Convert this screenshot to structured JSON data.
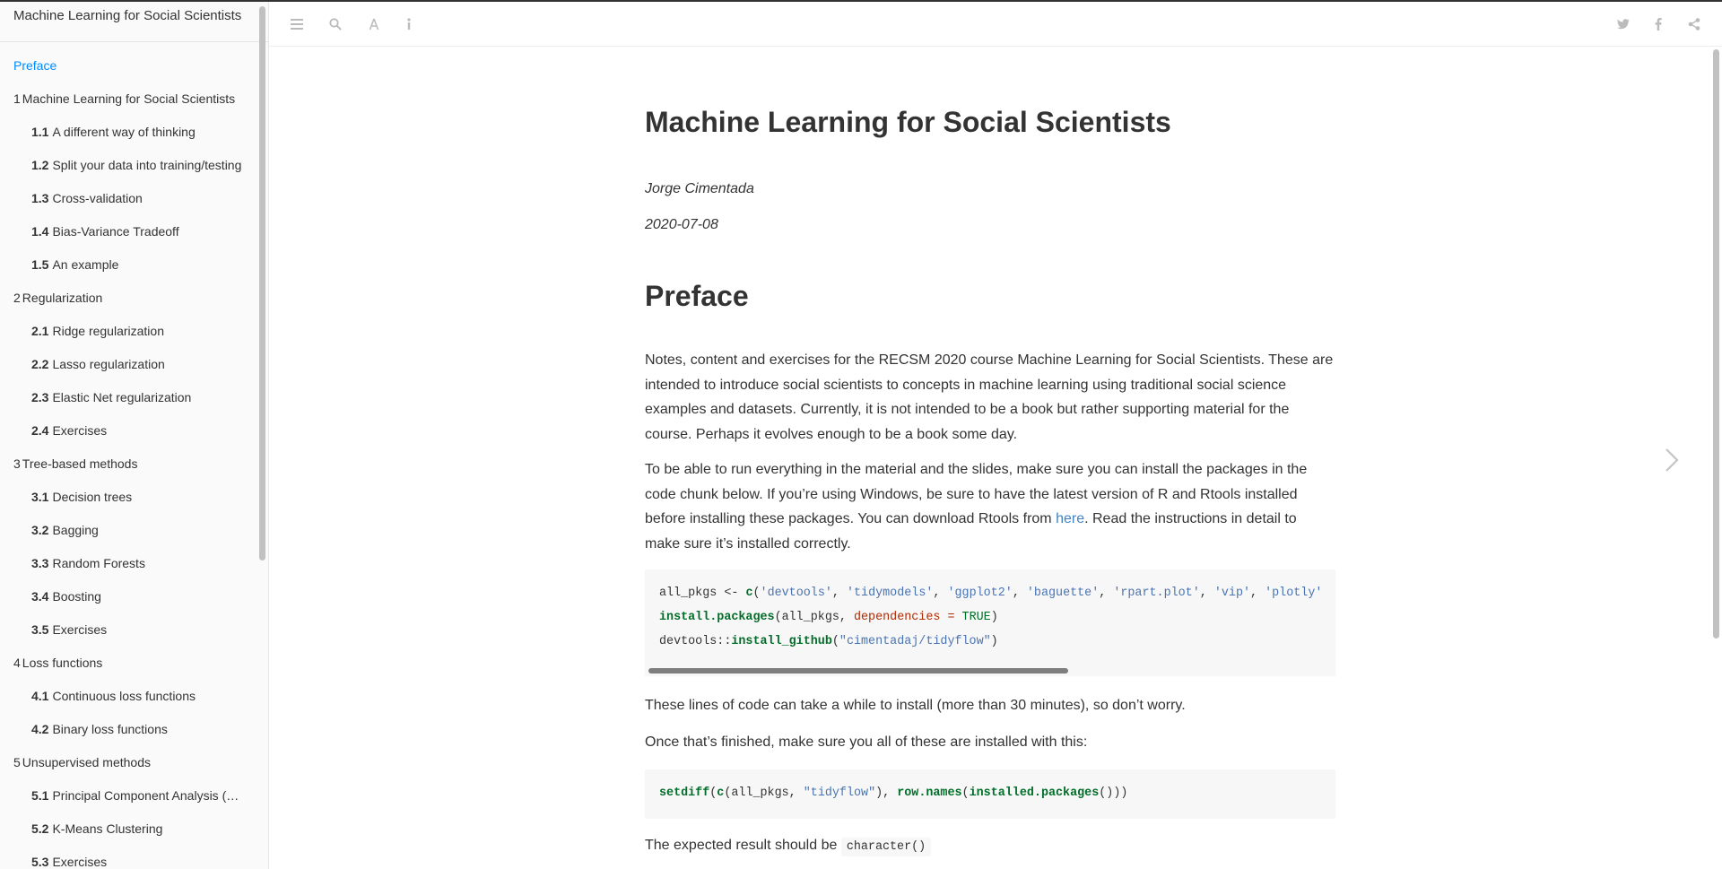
{
  "sidebar": {
    "title": "Machine Learning for Social Scientists",
    "items": [
      {
        "num": "",
        "label": "Preface",
        "level": 0,
        "active": true
      },
      {
        "num": "1",
        "label": "Machine Learning for Social Scientists",
        "level": 0
      },
      {
        "num": "1.1",
        "label": "A different way of thinking",
        "level": 1
      },
      {
        "num": "1.2",
        "label": "Split your data into training/testing",
        "level": 1
      },
      {
        "num": "1.3",
        "label": "Cross-validation",
        "level": 1
      },
      {
        "num": "1.4",
        "label": "Bias-Variance Tradeoff",
        "level": 1
      },
      {
        "num": "1.5",
        "label": "An example",
        "level": 1
      },
      {
        "num": "2",
        "label": "Regularization",
        "level": 0
      },
      {
        "num": "2.1",
        "label": "Ridge regularization",
        "level": 1
      },
      {
        "num": "2.2",
        "label": "Lasso regularization",
        "level": 1
      },
      {
        "num": "2.3",
        "label": "Elastic Net regularization",
        "level": 1
      },
      {
        "num": "2.4",
        "label": "Exercises",
        "level": 1
      },
      {
        "num": "3",
        "label": "Tree-based methods",
        "level": 0
      },
      {
        "num": "3.1",
        "label": "Decision trees",
        "level": 1
      },
      {
        "num": "3.2",
        "label": "Bagging",
        "level": 1
      },
      {
        "num": "3.3",
        "label": "Random Forests",
        "level": 1
      },
      {
        "num": "3.4",
        "label": "Boosting",
        "level": 1
      },
      {
        "num": "3.5",
        "label": "Exercises",
        "level": 1
      },
      {
        "num": "4",
        "label": "Loss functions",
        "level": 0
      },
      {
        "num": "4.1",
        "label": "Continuous loss functions",
        "level": 1
      },
      {
        "num": "4.2",
        "label": "Binary loss functions",
        "level": 1
      },
      {
        "num": "5",
        "label": "Unsupervised methods",
        "level": 0
      },
      {
        "num": "5.1",
        "label": "Principal Component Analysis (PCA)",
        "level": 1
      },
      {
        "num": "5.2",
        "label": "K-Means Clustering",
        "level": 1
      },
      {
        "num": "5.3",
        "label": "Exercises",
        "level": 1
      }
    ]
  },
  "toolbar": {
    "left_icons": [
      "menu-icon",
      "search-icon",
      "font-icon",
      "info-icon"
    ],
    "right_icons": [
      "twitter-icon",
      "facebook-icon",
      "share-icon"
    ],
    "icon_color": "#bbbbbb"
  },
  "main": {
    "title": "Machine Learning for Social Scientists",
    "author": "Jorge Cimentada",
    "date": "2020-07-08",
    "section_heading": "Preface",
    "para1": "Notes, content and exercises for the RECSM 2020 course Machine Learning for Social Scientists. These are intended to introduce social scientists to concepts in machine learning using traditional social science examples and datasets. Currently, it is not intended to be a book but rather supporting material for the course. Perhaps it evolves enough to be a book some day.",
    "para2_before_link": "To be able to run everything in the material and the slides, make sure you can install the packages in the code chunk below. If you’re using Windows, be sure to have the latest version of R and Rtools installed before installing these packages. You can download Rtools from ",
    "para2_link": "here",
    "para2_after_link": ". Read the instructions in detail to make sure it’s installed correctly.",
    "code1": {
      "line1": {
        "var": "all_pkgs <- ",
        "fn": "c",
        "open": "(",
        "strings": [
          "'devtools'",
          "'tidymodels'",
          "'ggplot2'",
          "'baguette'",
          "'rpart.plot'",
          "'vip'",
          "'plotly'"
        ],
        "sep": ", "
      },
      "line2": {
        "fn": "install.packages",
        "open": "(all_pkgs, ",
        "arg": "dependencies = ",
        "val": "TRUE",
        "close": ")"
      },
      "line3": {
        "prefix": "devtools::",
        "fn": "install_github",
        "open": "(",
        "str": "\"cimentadaj/tidyflow\"",
        "close": ")"
      }
    },
    "para3": "These lines of code can take a while to install (more than 30 minutes), so don’t worry.",
    "para4": "Once that’s finished, make sure you all of these are installed with this:",
    "code2": {
      "fn1": "setdiff",
      "p1": "(",
      "fn2": "c",
      "p2": "(all_pkgs, ",
      "str": "\"tidyflow\"",
      "p3": "), ",
      "fn3": "row.names",
      "p4": "(",
      "fn4": "installed.packages",
      "p5": "()))"
    },
    "para5": "The expected result should be ",
    "para5_code": "character()"
  },
  "colors": {
    "accent": "#008cff",
    "link": "#4183c4",
    "code_bg": "#f7f7f7",
    "code_fn": "#006e28",
    "code_str": "#4a74b1",
    "code_arg": "#b02b04"
  }
}
